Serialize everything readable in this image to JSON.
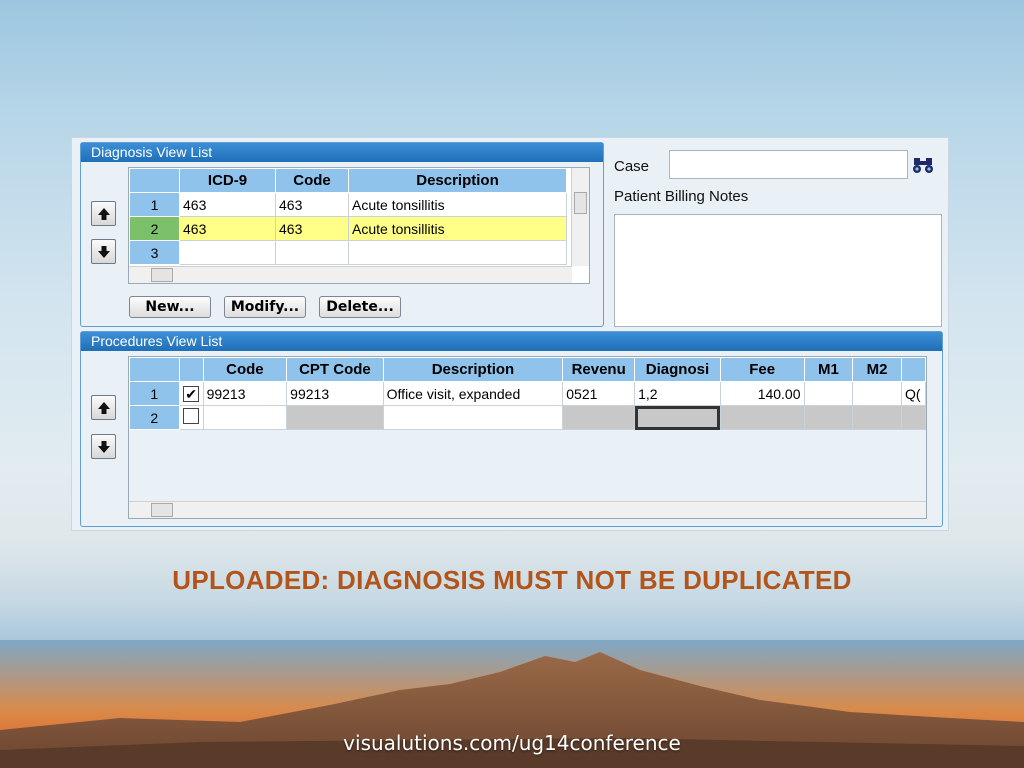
{
  "diagnosis": {
    "title": "Diagnosis View List",
    "columns": [
      "ICD-9",
      "Code",
      "Description"
    ],
    "rows": [
      {
        "num": "1",
        "icd9": "463",
        "code": "463",
        "description": "Acute tonsillitis"
      },
      {
        "num": "2",
        "icd9": "463",
        "code": "463",
        "description": "Acute tonsillitis"
      },
      {
        "num": "3",
        "icd9": "",
        "code": "",
        "description": ""
      }
    ],
    "buttons": {
      "new": "New...",
      "modify": "Modify...",
      "delete": "Delete..."
    }
  },
  "case": {
    "label": "Case",
    "value": ""
  },
  "billing_notes": {
    "label": "Patient Billing Notes",
    "value": ""
  },
  "procedures": {
    "title": "Procedures View List",
    "columns": [
      "",
      "Code",
      "CPT Code",
      "Description",
      "Revenu",
      "Diagnosi",
      "Fee",
      "M1",
      "M2",
      ""
    ],
    "rows": [
      {
        "num": "1",
        "checked": "✔",
        "code": "99213",
        "cpt": "99213",
        "description": "Office visit, expanded",
        "revenue": "0521",
        "diagnosis": "1,2",
        "fee": "140.00",
        "m1": "",
        "m2": "",
        "extra": "Q("
      },
      {
        "num": "2",
        "checked": "",
        "code": "",
        "cpt": "",
        "description": "",
        "revenue": "",
        "diagnosis": "",
        "fee": "",
        "m1": "",
        "m2": "",
        "extra": ""
      }
    ]
  },
  "headline": "UPLOADED: DIAGNOSIS MUST NOT BE DUPLICATED",
  "footer": "visualutions.com/ug14conference",
  "colors": {
    "accent": "#1f6fb8",
    "header": "#8fc3ec",
    "highlight": "#ffff88",
    "headline": "#b3541a"
  }
}
